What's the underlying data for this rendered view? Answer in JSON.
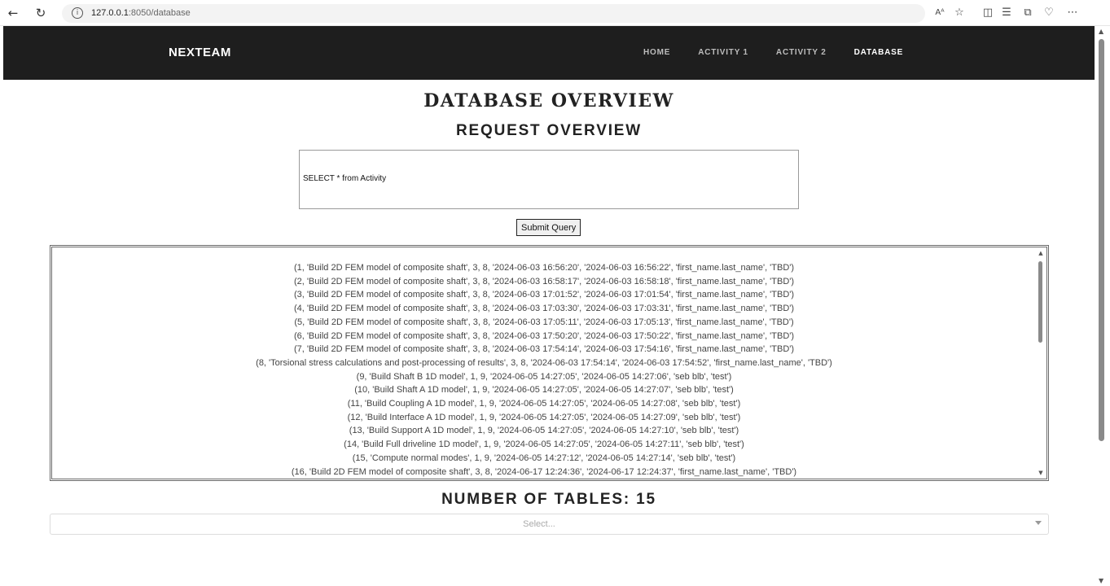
{
  "browser": {
    "url_host": "127.0.0.1",
    "url_rest": ":8050/database",
    "back_icon": "back-arrow-icon",
    "refresh_icon": "refresh-icon"
  },
  "header": {
    "brand": "NEXTEAM",
    "nav": [
      {
        "label": "HOME",
        "active": false
      },
      {
        "label": "ACTIVITY 1",
        "active": false
      },
      {
        "label": "ACTIVITY 2",
        "active": false
      },
      {
        "label": "DATABASE",
        "active": true
      }
    ]
  },
  "main": {
    "title": "DATABASE OVERVIEW",
    "subtitle": "REQUEST OVERVIEW",
    "query_value": "SELECT * from Activity",
    "submit_label": "Submit Query",
    "results": [
      "(1, 'Build 2D FEM model of composite shaft', 3, 8, '2024-06-03 16:56:20', '2024-06-03 16:56:22', 'first_name.last_name', 'TBD')",
      "(2, 'Build 2D FEM model of composite shaft', 3, 8, '2024-06-03 16:58:17', '2024-06-03 16:58:18', 'first_name.last_name', 'TBD')",
      "(3, 'Build 2D FEM model of composite shaft', 3, 8, '2024-06-03 17:01:52', '2024-06-03 17:01:54', 'first_name.last_name', 'TBD')",
      "(4, 'Build 2D FEM model of composite shaft', 3, 8, '2024-06-03 17:03:30', '2024-06-03 17:03:31', 'first_name.last_name', 'TBD')",
      "(5, 'Build 2D FEM model of composite shaft', 3, 8, '2024-06-03 17:05:11', '2024-06-03 17:05:13', 'first_name.last_name', 'TBD')",
      "(6, 'Build 2D FEM model of composite shaft', 3, 8, '2024-06-03 17:50:20', '2024-06-03 17:50:22', 'first_name.last_name', 'TBD')",
      "(7, 'Build 2D FEM model of composite shaft', 3, 8, '2024-06-03 17:54:14', '2024-06-03 17:54:16', 'first_name.last_name', 'TBD')",
      "(8, 'Torsional stress calculations and post-processing of results', 3, 8, '2024-06-03 17:54:14', '2024-06-03 17:54:52', 'first_name.last_name', 'TBD')",
      "(9, 'Build Shaft B 1D model', 1, 9, '2024-06-05 14:27:05', '2024-06-05 14:27:06', 'seb blb', 'test')",
      "(10, 'Build Shaft A 1D model', 1, 9, '2024-06-05 14:27:05', '2024-06-05 14:27:07', 'seb blb', 'test')",
      "(11, 'Build Coupling A 1D model', 1, 9, '2024-06-05 14:27:05', '2024-06-05 14:27:08', 'seb blb', 'test')",
      "(12, 'Build Interface A 1D model', 1, 9, '2024-06-05 14:27:05', '2024-06-05 14:27:09', 'seb blb', 'test')",
      "(13, 'Build Support A 1D model', 1, 9, '2024-06-05 14:27:05', '2024-06-05 14:27:10', 'seb blb', 'test')",
      "(14, 'Build Full driveline 1D model', 1, 9, '2024-06-05 14:27:05', '2024-06-05 14:27:11', 'seb blb', 'test')",
      "(15, 'Compute normal modes', 1, 9, '2024-06-05 14:27:12', '2024-06-05 14:27:14', 'seb blb', 'test')",
      "(16, 'Build 2D FEM model of composite shaft', 3, 8, '2024-06-17 12:24:36', '2024-06-17 12:24:37', 'first_name.last_name', 'TBD')"
    ],
    "tables_label": "NUMBER OF TABLES: 15",
    "select_placeholder": "Select..."
  }
}
